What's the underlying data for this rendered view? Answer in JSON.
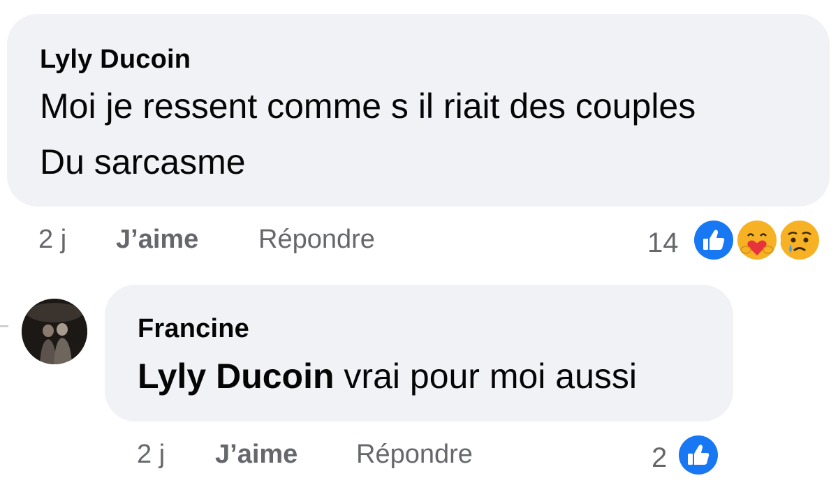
{
  "comments": [
    {
      "author": "Lyly Ducoin",
      "lines": [
        "Moi je ressent comme s il riait des couples",
        "Du sarcasme"
      ],
      "time": "2 j",
      "like_label": "J’aime",
      "reply_label": "Répondre",
      "reaction_count": "14",
      "reactions": [
        "like-icon",
        "care-icon",
        "sad-icon"
      ]
    },
    {
      "author": "Francine",
      "mention": "Lyly Ducoin",
      "text": " vrai pour moi aussi",
      "time": "2 j",
      "like_label": "J’aime",
      "reply_label": "Répondre",
      "reaction_count": "2",
      "reactions": [
        "like-icon"
      ]
    }
  ],
  "colors": {
    "bubble": "#f0f2f5",
    "text": "#050505",
    "meta": "#65676b",
    "like_blue": "#1877f2",
    "emoji_yellow": "#f7b125"
  }
}
